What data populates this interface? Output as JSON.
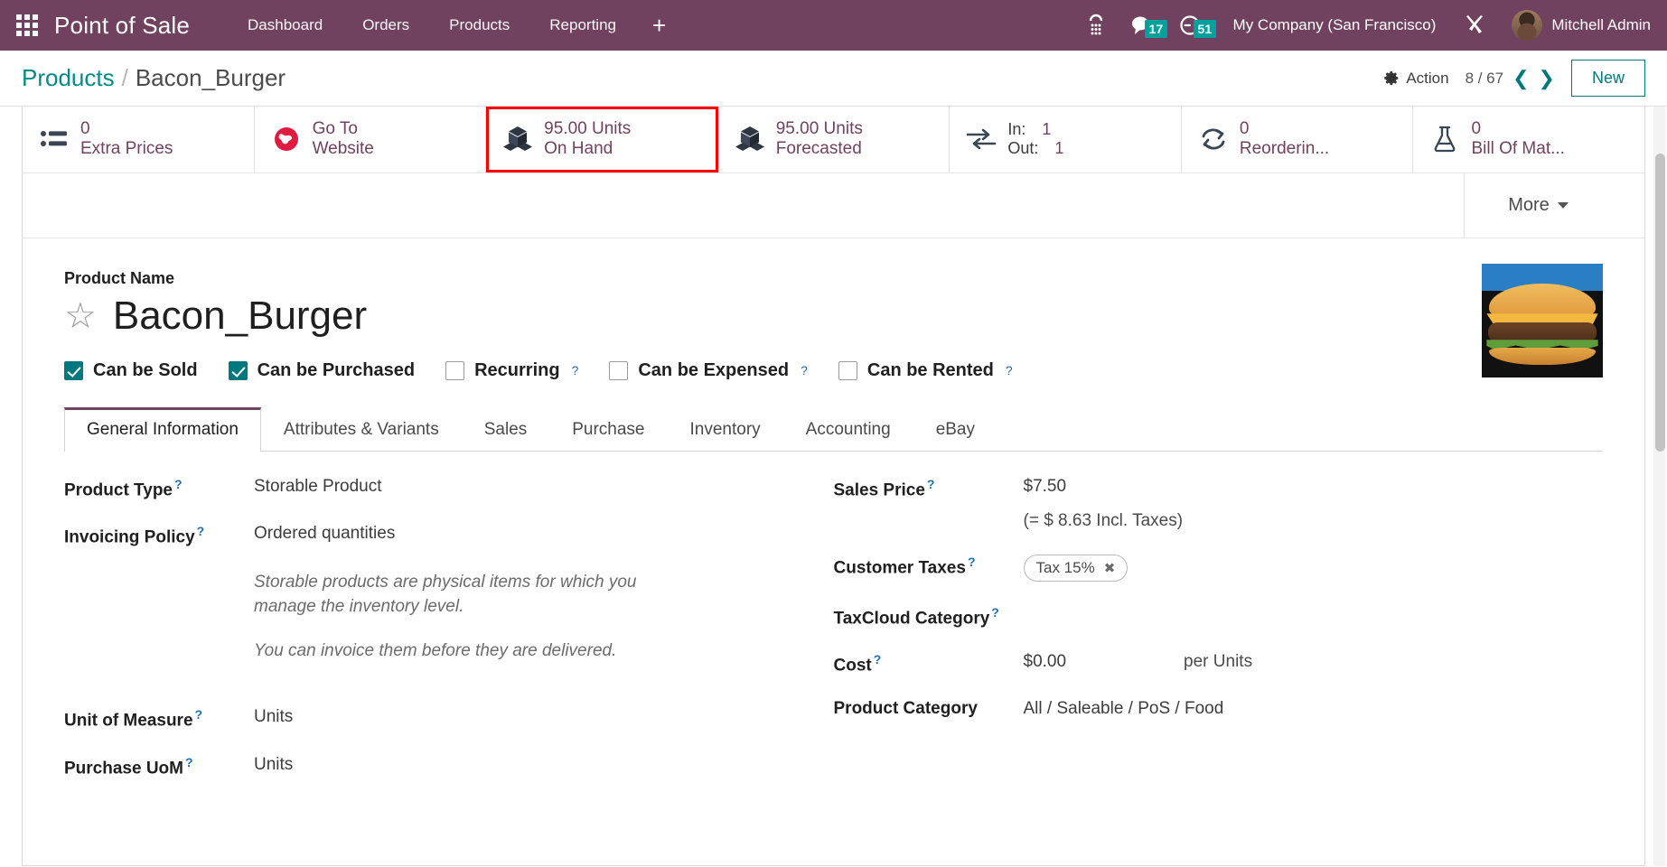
{
  "topnav": {
    "apps_icon": "apps-grid-icon",
    "brand": "Point of Sale",
    "menu": [
      {
        "label": "Dashboard"
      },
      {
        "label": "Orders"
      },
      {
        "label": "Products"
      },
      {
        "label": "Reporting"
      }
    ],
    "plus": "+",
    "systray": {
      "voip_icon": "dialpad-icon",
      "messages_icon": "chat-bubble-icon",
      "messages_count": "17",
      "activities_icon": "clock-icon",
      "activities_count": "51",
      "company": "My Company (San Francisco)",
      "tools_icon": "wrench-screwdriver-icon",
      "avatar": "user-avatar",
      "username": "Mitchell Admin"
    },
    "accent": "#71425f",
    "badge_color": "#00a09d"
  },
  "controlpanel": {
    "breadcrumb_parent": "Products",
    "breadcrumb_separator": "/",
    "breadcrumb_current": "Bacon_Burger",
    "action_label": "Action",
    "action_icon": "gear-icon",
    "pager": "8 / 67",
    "prev_icon": "chevron-left-icon",
    "next_icon": "chevron-right-icon",
    "new_label": "New",
    "teal": "#00787d"
  },
  "statbuttons": [
    {
      "icon": "list-icon",
      "value": "0",
      "label": "Extra Prices",
      "highlighted": false
    },
    {
      "icon": "globe-icon",
      "value": "Go To",
      "label": "Website",
      "highlighted": false
    },
    {
      "icon": "boxes-icon",
      "value": "95.00 Units",
      "label": "On Hand",
      "highlighted": true
    },
    {
      "icon": "boxes-icon",
      "value": "95.00 Units",
      "label": "Forecasted",
      "highlighted": false
    },
    {
      "icon": "exchange-arrows-icon",
      "in_label": "In:",
      "in_value": "1",
      "out_label": "Out:",
      "out_value": "1",
      "highlighted": false
    },
    {
      "icon": "refresh-icon",
      "value": "0",
      "label": "Reorderin...",
      "highlighted": false
    },
    {
      "icon": "flask-icon",
      "value": "0",
      "label": "Bill Of Mat...",
      "highlighted": false
    }
  ],
  "more_button": {
    "label": "More",
    "icon": "caret-down-icon"
  },
  "product": {
    "name_label": "Product Name",
    "name": "Bacon_Burger",
    "favorite_icon": "star-outline-icon",
    "image": "burger-photo"
  },
  "checkboxes": [
    {
      "label": "Can be Sold",
      "checked": true,
      "help": false
    },
    {
      "label": "Can be Purchased",
      "checked": true,
      "help": false
    },
    {
      "label": "Recurring",
      "checked": false,
      "help": true
    },
    {
      "label": "Can be Expensed",
      "checked": false,
      "help": true
    },
    {
      "label": "Can be Rented",
      "checked": false,
      "help": true
    }
  ],
  "tabs": [
    {
      "label": "General Information",
      "active": true
    },
    {
      "label": "Attributes & Variants",
      "active": false
    },
    {
      "label": "Sales",
      "active": false
    },
    {
      "label": "Purchase",
      "active": false
    },
    {
      "label": "Inventory",
      "active": false
    },
    {
      "label": "Accounting",
      "active": false
    },
    {
      "label": "eBay",
      "active": false
    }
  ],
  "left_fields": {
    "product_type_label": "Product Type",
    "product_type_value": "Storable Product",
    "invoicing_policy_label": "Invoicing Policy",
    "invoicing_policy_value": "Ordered quantities",
    "help_1": "Storable products are physical items for which you manage the inventory level.",
    "help_2": "You can invoice them before they are delivered.",
    "uom_label": "Unit of Measure",
    "uom_value": "Units",
    "purchase_uom_label": "Purchase UoM",
    "purchase_uom_value": "Units"
  },
  "right_fields": {
    "sales_price_label": "Sales Price",
    "sales_price_value": "$7.50",
    "sales_price_incl": "(= $ 8.63 Incl. Taxes)",
    "customer_taxes_label": "Customer Taxes",
    "customer_taxes_tag": "Tax 15%",
    "tag_remove_icon": "close-icon",
    "taxcloud_label": "TaxCloud Category",
    "taxcloud_value": "",
    "cost_label": "Cost",
    "cost_value": "$0.00",
    "cost_uom": "per Units",
    "product_category_label": "Product Category",
    "product_category_value": "All / Saleable / PoS / Food"
  }
}
